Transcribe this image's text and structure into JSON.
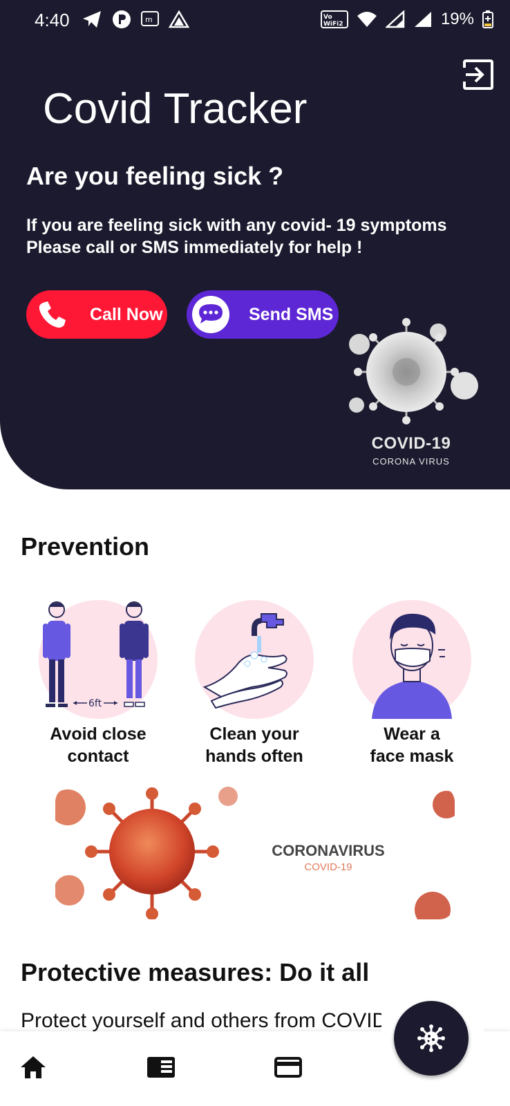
{
  "status_bar": {
    "time": "4:40",
    "battery": "19%",
    "icons_left": [
      "telegram-icon",
      "podcast-icon",
      "message-icon",
      "app-icon"
    ],
    "icons_right": [
      "vowifi-icon",
      "wifi-icon",
      "signal-icon",
      "signal-icon",
      "battery-icon"
    ]
  },
  "header": {
    "title": "Covid Tracker",
    "sick_title": "Are you feeling sick ?",
    "sick_line1": "If you are feeling sick with any covid- 19 symptoms",
    "sick_line2": "Please call or SMS immediately for help !",
    "call_label": "Call Now",
    "sms_label": "Send SMS",
    "covid_main": "COVID-19",
    "covid_sub": "CORONA VIRUS"
  },
  "prevention": {
    "title": "Prevention",
    "items": [
      {
        "line1": "Avoid close",
        "line2": "contact",
        "distance": "6ft"
      },
      {
        "line1": "Clean your",
        "line2": "hands often"
      },
      {
        "line1": "Wear a",
        "line2": "face mask"
      }
    ]
  },
  "banner": {
    "title": "CORONAVIRUS",
    "subtitle": "COVID-19"
  },
  "protective": {
    "title": "Protective measures: Do it all",
    "text": "Protect yourself and others from COVID-"
  },
  "colors": {
    "header_bg": "#1b1a2e",
    "call_button": "#ff1736",
    "sms_button": "#5e27d6",
    "circle_pink": "#fde2ea"
  },
  "nav": {
    "icons": [
      "home-icon",
      "news-icon",
      "card-icon",
      "virus-icon"
    ]
  }
}
